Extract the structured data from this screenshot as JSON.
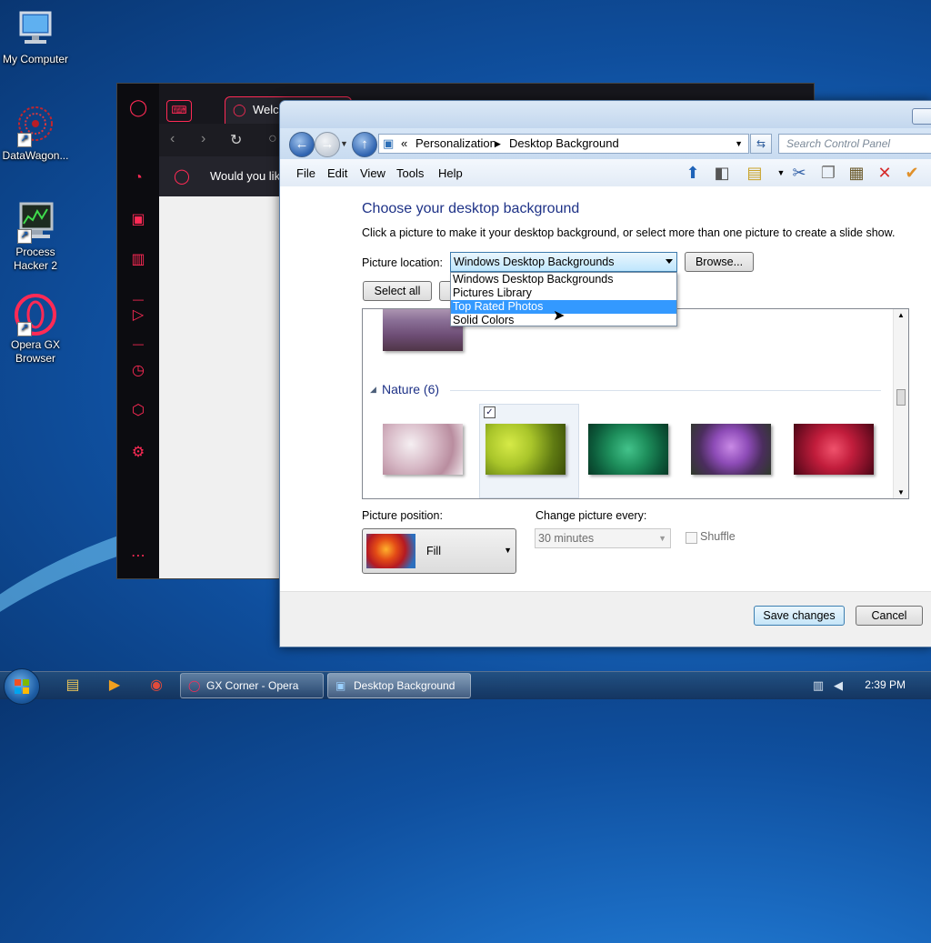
{
  "desktop": {
    "icons": [
      {
        "label": "My Computer"
      },
      {
        "label": "DataWagon..."
      },
      {
        "label": "Process Hacker 2"
      },
      {
        "label": "Opera GX Browser"
      }
    ]
  },
  "opera": {
    "tab_title": "Welcome to O",
    "infobar_text": "Would you like"
  },
  "cp": {
    "breadcrumb_prefix": "«",
    "breadcrumb": [
      "Personalization",
      "Desktop Background"
    ],
    "search_placeholder": "Search Control Panel",
    "menu": [
      "File",
      "Edit",
      "View",
      "Tools",
      "Help"
    ],
    "heading": "Choose your desktop background",
    "description": "Click a picture to make it your desktop background, or select more than one picture to create a slide show.",
    "picture_location_label": "Picture location:",
    "picture_location_value": "Windows Desktop Backgrounds",
    "browse_label": "Browse...",
    "select_all_label": "Select all",
    "dropdown_options": [
      "Windows Desktop Backgrounds",
      "Pictures Library",
      "Top Rated Photos",
      "Solid Colors"
    ],
    "dropdown_selected_index": 2,
    "section_title": "Nature (6)",
    "picture_position_label": "Picture position:",
    "picture_position_value": "Fill",
    "change_every_label": "Change picture every:",
    "change_every_value": "30 minutes",
    "shuffle_label": "Shuffle",
    "save_label": "Save changes",
    "cancel_label": "Cancel"
  },
  "taskbar": {
    "tasks": [
      {
        "label": "GX Corner - Opera"
      },
      {
        "label": "Desktop Background"
      }
    ],
    "clock": "2:39 PM"
  },
  "colors": {
    "opera_accent": "#ff2a55",
    "cp_heading": "#1e3287",
    "selection": "#3399ff"
  }
}
